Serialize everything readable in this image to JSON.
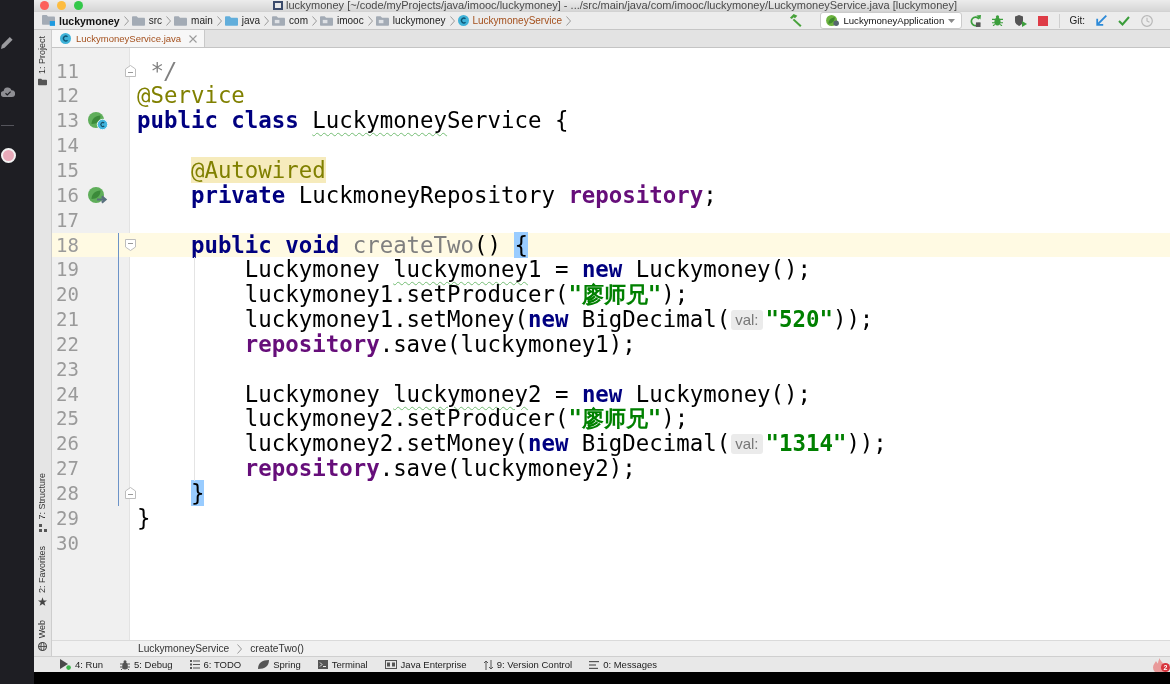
{
  "window": {
    "title": "luckymoney [~/code/myProjects/java/imooc/luckymoney] - .../src/main/java/com/imooc/luckymoney/LuckymoneyService.java [luckymoney]"
  },
  "navigation_bar": {
    "breadcrumbs": [
      {
        "label": "luckymoney",
        "kind": "module"
      },
      {
        "label": "src",
        "kind": "folder"
      },
      {
        "label": "main",
        "kind": "folder"
      },
      {
        "label": "java",
        "kind": "source_root"
      },
      {
        "label": "com",
        "kind": "package"
      },
      {
        "label": "imooc",
        "kind": "package"
      },
      {
        "label": "luckymoney",
        "kind": "package"
      },
      {
        "label": "LuckymoneyService",
        "kind": "class"
      }
    ],
    "run_configuration": "LuckymoneyApplication",
    "git_label": "Git:"
  },
  "tool_strip": [
    {
      "label": "1: Project",
      "kind": "project"
    },
    {
      "label": "7: Structure",
      "kind": "structure"
    },
    {
      "label": "2: Favorites",
      "kind": "favorites"
    },
    {
      "label": "Web",
      "kind": "web"
    }
  ],
  "editor_tabs": [
    {
      "label": "LuckymoneyService.java",
      "selected": true
    }
  ],
  "editor": {
    "lines": [
      {
        "number": "11",
        "current": false,
        "changed": false,
        "fold_marker": {
          "kind": "end"
        },
        "tokens": [
          {
            "text": " */",
            "kind": "comment"
          }
        ]
      },
      {
        "number": "12",
        "current": false,
        "changed": false,
        "tokens": [
          {
            "text": "@Service",
            "kind": "annotation"
          }
        ]
      },
      {
        "number": "13",
        "current": false,
        "changed": false,
        "gutter_icon": {
          "kind": "bean"
        },
        "tokens": [
          {
            "text": "public class ",
            "kind": "keyword"
          },
          {
            "text": "Luckymoney",
            "kind": "typo"
          },
          {
            "text": "Service {",
            "kind": "plain"
          }
        ]
      },
      {
        "number": "14",
        "current": false,
        "changed": false
      },
      {
        "number": "15",
        "current": false,
        "changed": false,
        "tokens": [
          {
            "text": "    @Autowired",
            "kind": "annotation_marked"
          }
        ]
      },
      {
        "number": "16",
        "current": false,
        "changed": false,
        "gutter_icon": {
          "kind": "autowired"
        },
        "tokens": [
          {
            "text": "    private ",
            "kind": "keyword"
          },
          {
            "text": "LuckmoneyRepository ",
            "kind": "plain"
          },
          {
            "text": "repository",
            "kind": "field"
          },
          {
            "text": ";",
            "kind": "plain"
          }
        ]
      },
      {
        "number": "17",
        "current": false,
        "changed": false
      },
      {
        "number": "18",
        "current": true,
        "changed": true,
        "fold_marker": {
          "kind": "start"
        },
        "tokens": [
          {
            "text": "    public void ",
            "kind": "keyword"
          },
          {
            "text": "createTwo",
            "kind": "unused"
          },
          {
            "text": "() ",
            "kind": "plain"
          },
          {
            "text": "{",
            "kind": "brace_match"
          }
        ]
      },
      {
        "number": "19",
        "current": false,
        "changed": true,
        "tokens": [
          {
            "text": "        Luckymoney ",
            "kind": "plain"
          },
          {
            "text": "luckymoney",
            "kind": "typo"
          },
          {
            "text": "1 = ",
            "kind": "plain"
          },
          {
            "text": "new ",
            "kind": "keyword"
          },
          {
            "text": "Luckymoney();",
            "kind": "plain"
          }
        ]
      },
      {
        "number": "20",
        "current": false,
        "changed": true,
        "tokens": [
          {
            "text": "        luckymoney1.setProducer(",
            "kind": "plain"
          },
          {
            "text": "\"廖师兄\"",
            "kind": "string"
          },
          {
            "text": ");",
            "kind": "plain"
          }
        ]
      },
      {
        "number": "21",
        "current": false,
        "changed": true,
        "tokens": [
          {
            "text": "        luckymoney1.setMoney(",
            "kind": "plain"
          },
          {
            "text": "new ",
            "kind": "keyword"
          },
          {
            "text": "BigDecimal(",
            "kind": "plain"
          },
          {
            "text": "val:",
            "kind": "hint"
          },
          {
            "text": "\"520\"",
            "kind": "string"
          },
          {
            "text": "));",
            "kind": "plain"
          }
        ]
      },
      {
        "number": "22",
        "current": false,
        "changed": true,
        "tokens": [
          {
            "text": "        repository",
            "kind": "field"
          },
          {
            "text": ".save(luckymoney1);",
            "kind": "plain"
          }
        ]
      },
      {
        "number": "23",
        "current": false,
        "changed": true
      },
      {
        "number": "24",
        "current": false,
        "changed": true,
        "tokens": [
          {
            "text": "        Luckymoney ",
            "kind": "plain"
          },
          {
            "text": "luckymoney",
            "kind": "typo"
          },
          {
            "text": "2 = ",
            "kind": "plain"
          },
          {
            "text": "new ",
            "kind": "keyword"
          },
          {
            "text": "Luckymoney();",
            "kind": "plain"
          }
        ]
      },
      {
        "number": "25",
        "current": false,
        "changed": true,
        "tokens": [
          {
            "text": "        luckymoney2.setProducer(",
            "kind": "plain"
          },
          {
            "text": "\"廖师兄\"",
            "kind": "string"
          },
          {
            "text": ");",
            "kind": "plain"
          }
        ]
      },
      {
        "number": "26",
        "current": false,
        "changed": true,
        "tokens": [
          {
            "text": "        luckymoney2.setMoney(",
            "kind": "plain"
          },
          {
            "text": "new ",
            "kind": "keyword"
          },
          {
            "text": "BigDecimal(",
            "kind": "plain"
          },
          {
            "text": "val:",
            "kind": "hint"
          },
          {
            "text": "\"1314\"",
            "kind": "string"
          },
          {
            "text": "));",
            "kind": "plain"
          }
        ]
      },
      {
        "number": "27",
        "current": false,
        "changed": true,
        "tokens": [
          {
            "text": "        repository",
            "kind": "field"
          },
          {
            "text": ".save(luckymoney2);",
            "kind": "plain"
          }
        ]
      },
      {
        "number": "28",
        "current": false,
        "changed": true,
        "fold_marker": {
          "kind": "end"
        },
        "tokens": [
          {
            "text": "    }",
            "kind": "brace_match"
          }
        ]
      },
      {
        "number": "29",
        "current": false,
        "changed": false,
        "tokens": [
          {
            "text": "}",
            "kind": "plain"
          }
        ]
      },
      {
        "number": "30",
        "current": false,
        "changed": false
      }
    ]
  },
  "breadcrumb_footer": [
    {
      "label": "LuckymoneyService"
    },
    {
      "label": "createTwo()"
    }
  ],
  "tool_windows": [
    {
      "label": "4: Run",
      "kind": "run"
    },
    {
      "label": "5: Debug",
      "kind": "debug"
    },
    {
      "label": "6: TODO",
      "kind": "todo"
    },
    {
      "label": "Spring",
      "kind": "spring"
    },
    {
      "label": "Terminal",
      "kind": "terminal"
    },
    {
      "label": "Java Enterprise",
      "kind": "java_enterprise"
    },
    {
      "label": "9: Version Control",
      "kind": "version_control"
    },
    {
      "label": "0: Messages",
      "kind": "messages"
    }
  ],
  "event_log": {
    "count": "2"
  }
}
